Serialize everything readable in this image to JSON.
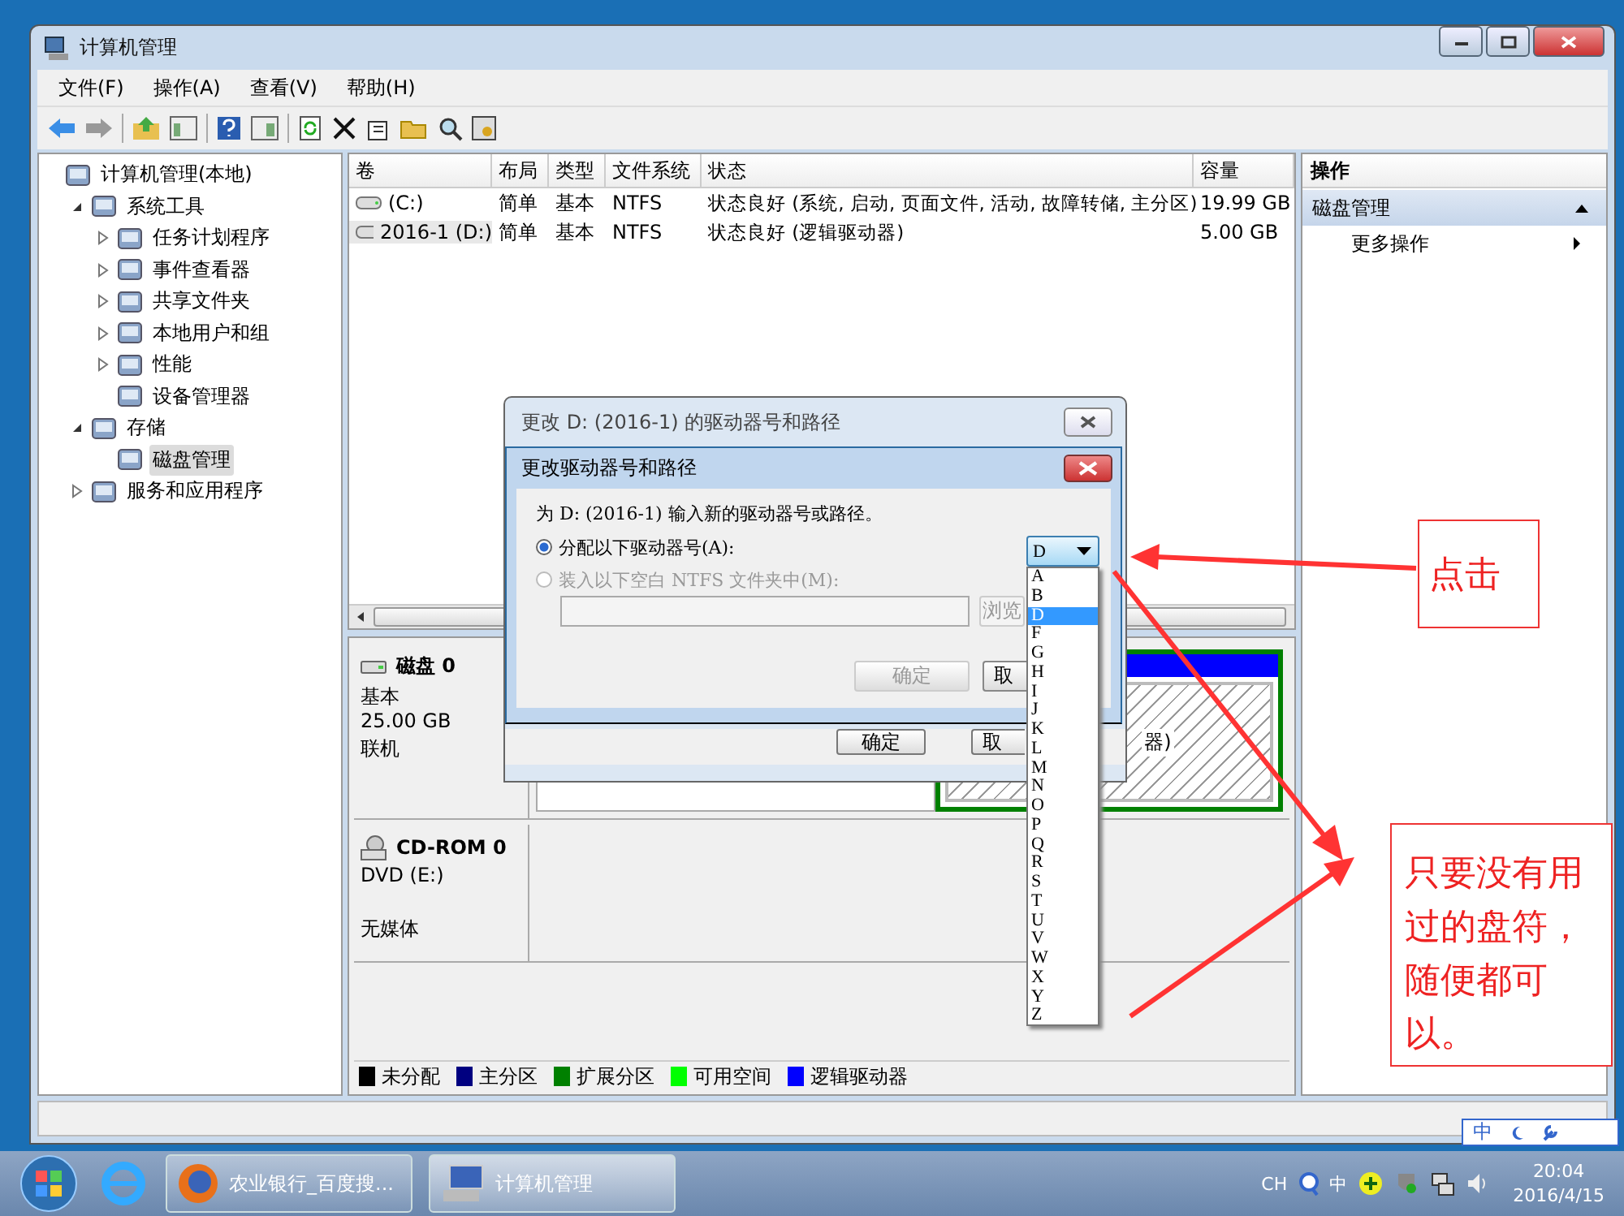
{
  "window": {
    "title": "计算机管理"
  },
  "menu": [
    "文件(F)",
    "操作(A)",
    "查看(V)",
    "帮助(H)"
  ],
  "tree": {
    "label": "计算机管理(本地)",
    "selected": false,
    "children": [
      {
        "label": "系统工具",
        "selected": false,
        "expanded": true,
        "children": [
          {
            "label": "任务计划程序",
            "selected": false,
            "expanded": false
          },
          {
            "label": "事件查看器",
            "selected": false,
            "expanded": false
          },
          {
            "label": "共享文件夹",
            "selected": false,
            "expanded": false
          },
          {
            "label": "本地用户和组",
            "selected": false,
            "expanded": false
          },
          {
            "label": "性能",
            "selected": false,
            "expanded": false
          },
          {
            "label": "设备管理器",
            "selected": false
          }
        ]
      },
      {
        "label": "存储",
        "selected": false,
        "expanded": true,
        "children": [
          {
            "label": "磁盘管理",
            "selected": true
          }
        ]
      },
      {
        "label": "服务和应用程序",
        "selected": false,
        "expanded": false
      }
    ]
  },
  "table": {
    "columns": [
      "卷",
      "布局",
      "类型",
      "文件系统",
      "状态",
      "容量"
    ],
    "rows": [
      {
        "cells": [
          "(C:)",
          "简单",
          "基本",
          "NTFS",
          "状态良好 (系统, 启动, 页面文件, 活动, 故障转储, 主分区)",
          "19.99 GB"
        ],
        "selected": false
      },
      {
        "cells": [
          "2016-1 (D:)",
          "简单",
          "基本",
          "NTFS",
          "状态良好 (逻辑驱动器)",
          "5.00 GB"
        ],
        "selected": true
      }
    ]
  },
  "disks": [
    {
      "kind": "disk",
      "name": "磁盘 0",
      "lines": [
        "基本",
        "25.00 GB",
        "联机"
      ],
      "partition_label": "器)"
    },
    {
      "kind": "cdrom",
      "name": "CD-ROM 0",
      "lines": [
        "DVD (E:)",
        "无媒体"
      ]
    }
  ],
  "legend": [
    {
      "label": "未分配",
      "color": "#000000"
    },
    {
      "label": "主分区",
      "color": "#000080"
    },
    {
      "label": "扩展分区",
      "color": "#008000"
    },
    {
      "label": "可用空间",
      "color": "#00ff00"
    },
    {
      "label": "逻辑驱动器",
      "color": "#0000ff"
    }
  ],
  "actions": {
    "title": "操作",
    "section": "磁盘管理",
    "item": "更多操作"
  },
  "outer_dialog": {
    "title": "更改 D: (2016-1) 的驱动器号和路径",
    "buttons": [
      "确定",
      "取"
    ]
  },
  "dialog": {
    "title": "更改驱动器号和路径",
    "prompt": "为 D: (2016-1) 输入新的驱动器号或路径。",
    "options": [
      {
        "label": "分配以下驱动器号(A):",
        "checked": true,
        "disabled": false
      },
      {
        "label": "装入以下空白 NTFS 文件夹中(M):",
        "checked": false,
        "disabled": true
      }
    ],
    "browse": {
      "label": "浏览",
      "disabled": true
    },
    "ok": {
      "label": "确定",
      "disabled": true
    },
    "cancel": {
      "label": "取",
      "disabled": false
    },
    "drive": {
      "value": "D",
      "options": [
        {
          "label": "A",
          "selected": false
        },
        {
          "label": "B",
          "selected": false
        },
        {
          "label": "D",
          "selected": true
        },
        {
          "label": "F",
          "selected": false
        },
        {
          "label": "G",
          "selected": false
        },
        {
          "label": "H",
          "selected": false
        },
        {
          "label": "I",
          "selected": false
        },
        {
          "label": "J",
          "selected": false
        },
        {
          "label": "K",
          "selected": false
        },
        {
          "label": "L",
          "selected": false
        },
        {
          "label": "M",
          "selected": false
        },
        {
          "label": "N",
          "selected": false
        },
        {
          "label": "O",
          "selected": false
        },
        {
          "label": "P",
          "selected": false
        },
        {
          "label": "Q",
          "selected": false
        },
        {
          "label": "R",
          "selected": false
        },
        {
          "label": "S",
          "selected": false
        },
        {
          "label": "T",
          "selected": false
        },
        {
          "label": "U",
          "selected": false
        },
        {
          "label": "V",
          "selected": false
        },
        {
          "label": "W",
          "selected": false
        },
        {
          "label": "X",
          "selected": false
        },
        {
          "label": "Y",
          "selected": false
        },
        {
          "label": "Z",
          "selected": false
        }
      ]
    }
  },
  "annotations": [
    "点击",
    "只要没有用过的盘符，随便都可以。"
  ],
  "ime_bar": {
    "label": "中"
  },
  "taskbar": {
    "tasks": [
      {
        "label": "农业银行_百度搜...",
        "selected": false
      },
      {
        "label": "计算机管理",
        "selected": true
      }
    ],
    "tray": {
      "lang": "CH",
      "ime": "中",
      "time": "20:04",
      "date": "2016/4/15"
    }
  }
}
